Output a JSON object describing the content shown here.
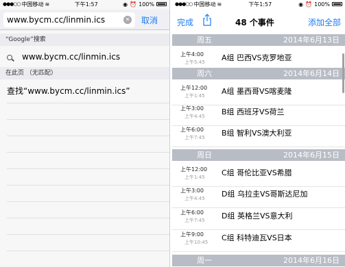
{
  "left": {
    "status": {
      "carrier": "中国移动",
      "time": "下午1:57",
      "battery": "100%"
    },
    "search": {
      "value": "www.bycm.cc/linmin.ics",
      "cancel": "取消"
    },
    "google_header": "“Google”搜索",
    "suggestion": "www.bycm.cc/linmin.ics",
    "on_page_header": "在此页 （无匹配）",
    "find_row": "查找“www.bycm.cc/linmin.ics”"
  },
  "right": {
    "status": {
      "carrier": "中国移动",
      "time": "下午1:57",
      "battery": "100%"
    },
    "nav": {
      "done": "完成",
      "title": "48 个事件",
      "add_all": "添加全部"
    },
    "days": [
      {
        "day": "周五",
        "date": "2014年6月13日",
        "events": [
          {
            "start": "上午4:00",
            "end": "上午5:45",
            "title": "A组 巴西VS克罗地亚"
          }
        ]
      },
      {
        "day": "周六",
        "date": "2014年6月14日",
        "events": [
          {
            "start": "上午12:00",
            "end": "上午1:45",
            "title": "A组 墨西哥VS喀麦隆"
          },
          {
            "start": "上午3:00",
            "end": "上午4:45",
            "title": "B组 西班牙VS荷兰"
          },
          {
            "start": "上午6:00",
            "end": "上午7:45",
            "title": "B组 智利VS澳大利亚"
          }
        ]
      },
      {
        "day": "周日",
        "date": "2014年6月15日",
        "events": [
          {
            "start": "上午12:00",
            "end": "上午1:45",
            "title": "C组 哥伦比亚VS希腊"
          },
          {
            "start": "上午3:00",
            "end": "上午4:45",
            "title": "D组 乌拉圭VS哥斯达尼加"
          },
          {
            "start": "上午6:00",
            "end": "上午7:45",
            "title": "D组 英格兰VS意大利"
          },
          {
            "start": "上午9:00",
            "end": "上午10:45",
            "title": "C组 科特迪瓦VS日本"
          }
        ]
      },
      {
        "day": "周一",
        "date": "2014年6月16日",
        "events": []
      }
    ]
  }
}
